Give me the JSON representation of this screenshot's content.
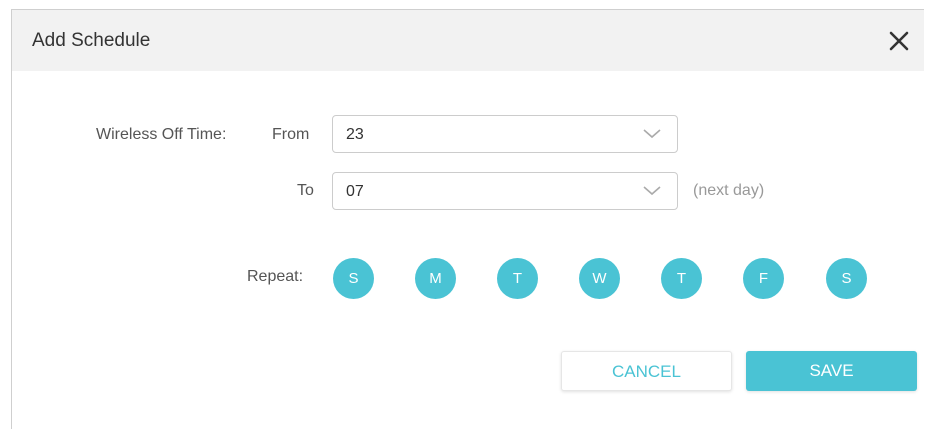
{
  "dialog": {
    "title": "Add Schedule",
    "close_icon": "close-icon"
  },
  "form": {
    "off_time_label": "Wireless Off Time:",
    "from_label": "From",
    "from_value": "23",
    "to_label": "To",
    "to_value": "07",
    "next_day_hint": "(next day)",
    "repeat_label": "Repeat:",
    "days": [
      "S",
      "M",
      "T",
      "W",
      "T",
      "F",
      "S"
    ]
  },
  "buttons": {
    "cancel_label": "CANCEL",
    "save_label": "SAVE"
  },
  "colors": {
    "accent": "#4ac3d4",
    "header_bg": "#f2f2f2"
  }
}
